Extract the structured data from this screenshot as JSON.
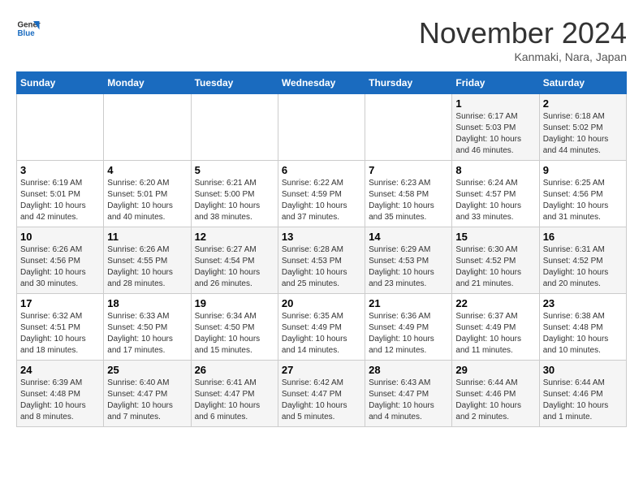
{
  "logo": {
    "line1": "General",
    "line2": "Blue"
  },
  "title": "November 2024",
  "location": "Kanmaki, Nara, Japan",
  "headers": [
    "Sunday",
    "Monday",
    "Tuesday",
    "Wednesday",
    "Thursday",
    "Friday",
    "Saturday"
  ],
  "weeks": [
    [
      {
        "day": "",
        "info": ""
      },
      {
        "day": "",
        "info": ""
      },
      {
        "day": "",
        "info": ""
      },
      {
        "day": "",
        "info": ""
      },
      {
        "day": "",
        "info": ""
      },
      {
        "day": "1",
        "info": "Sunrise: 6:17 AM\nSunset: 5:03 PM\nDaylight: 10 hours\nand 46 minutes."
      },
      {
        "day": "2",
        "info": "Sunrise: 6:18 AM\nSunset: 5:02 PM\nDaylight: 10 hours\nand 44 minutes."
      }
    ],
    [
      {
        "day": "3",
        "info": "Sunrise: 6:19 AM\nSunset: 5:01 PM\nDaylight: 10 hours\nand 42 minutes."
      },
      {
        "day": "4",
        "info": "Sunrise: 6:20 AM\nSunset: 5:01 PM\nDaylight: 10 hours\nand 40 minutes."
      },
      {
        "day": "5",
        "info": "Sunrise: 6:21 AM\nSunset: 5:00 PM\nDaylight: 10 hours\nand 38 minutes."
      },
      {
        "day": "6",
        "info": "Sunrise: 6:22 AM\nSunset: 4:59 PM\nDaylight: 10 hours\nand 37 minutes."
      },
      {
        "day": "7",
        "info": "Sunrise: 6:23 AM\nSunset: 4:58 PM\nDaylight: 10 hours\nand 35 minutes."
      },
      {
        "day": "8",
        "info": "Sunrise: 6:24 AM\nSunset: 4:57 PM\nDaylight: 10 hours\nand 33 minutes."
      },
      {
        "day": "9",
        "info": "Sunrise: 6:25 AM\nSunset: 4:56 PM\nDaylight: 10 hours\nand 31 minutes."
      }
    ],
    [
      {
        "day": "10",
        "info": "Sunrise: 6:26 AM\nSunset: 4:56 PM\nDaylight: 10 hours\nand 30 minutes."
      },
      {
        "day": "11",
        "info": "Sunrise: 6:26 AM\nSunset: 4:55 PM\nDaylight: 10 hours\nand 28 minutes."
      },
      {
        "day": "12",
        "info": "Sunrise: 6:27 AM\nSunset: 4:54 PM\nDaylight: 10 hours\nand 26 minutes."
      },
      {
        "day": "13",
        "info": "Sunrise: 6:28 AM\nSunset: 4:53 PM\nDaylight: 10 hours\nand 25 minutes."
      },
      {
        "day": "14",
        "info": "Sunrise: 6:29 AM\nSunset: 4:53 PM\nDaylight: 10 hours\nand 23 minutes."
      },
      {
        "day": "15",
        "info": "Sunrise: 6:30 AM\nSunset: 4:52 PM\nDaylight: 10 hours\nand 21 minutes."
      },
      {
        "day": "16",
        "info": "Sunrise: 6:31 AM\nSunset: 4:52 PM\nDaylight: 10 hours\nand 20 minutes."
      }
    ],
    [
      {
        "day": "17",
        "info": "Sunrise: 6:32 AM\nSunset: 4:51 PM\nDaylight: 10 hours\nand 18 minutes."
      },
      {
        "day": "18",
        "info": "Sunrise: 6:33 AM\nSunset: 4:50 PM\nDaylight: 10 hours\nand 17 minutes."
      },
      {
        "day": "19",
        "info": "Sunrise: 6:34 AM\nSunset: 4:50 PM\nDaylight: 10 hours\nand 15 minutes."
      },
      {
        "day": "20",
        "info": "Sunrise: 6:35 AM\nSunset: 4:49 PM\nDaylight: 10 hours\nand 14 minutes."
      },
      {
        "day": "21",
        "info": "Sunrise: 6:36 AM\nSunset: 4:49 PM\nDaylight: 10 hours\nand 12 minutes."
      },
      {
        "day": "22",
        "info": "Sunrise: 6:37 AM\nSunset: 4:49 PM\nDaylight: 10 hours\nand 11 minutes."
      },
      {
        "day": "23",
        "info": "Sunrise: 6:38 AM\nSunset: 4:48 PM\nDaylight: 10 hours\nand 10 minutes."
      }
    ],
    [
      {
        "day": "24",
        "info": "Sunrise: 6:39 AM\nSunset: 4:48 PM\nDaylight: 10 hours\nand 8 minutes."
      },
      {
        "day": "25",
        "info": "Sunrise: 6:40 AM\nSunset: 4:47 PM\nDaylight: 10 hours\nand 7 minutes."
      },
      {
        "day": "26",
        "info": "Sunrise: 6:41 AM\nSunset: 4:47 PM\nDaylight: 10 hours\nand 6 minutes."
      },
      {
        "day": "27",
        "info": "Sunrise: 6:42 AM\nSunset: 4:47 PM\nDaylight: 10 hours\nand 5 minutes."
      },
      {
        "day": "28",
        "info": "Sunrise: 6:43 AM\nSunset: 4:47 PM\nDaylight: 10 hours\nand 4 minutes."
      },
      {
        "day": "29",
        "info": "Sunrise: 6:44 AM\nSunset: 4:46 PM\nDaylight: 10 hours\nand 2 minutes."
      },
      {
        "day": "30",
        "info": "Sunrise: 6:44 AM\nSunset: 4:46 PM\nDaylight: 10 hours\nand 1 minute."
      }
    ]
  ]
}
